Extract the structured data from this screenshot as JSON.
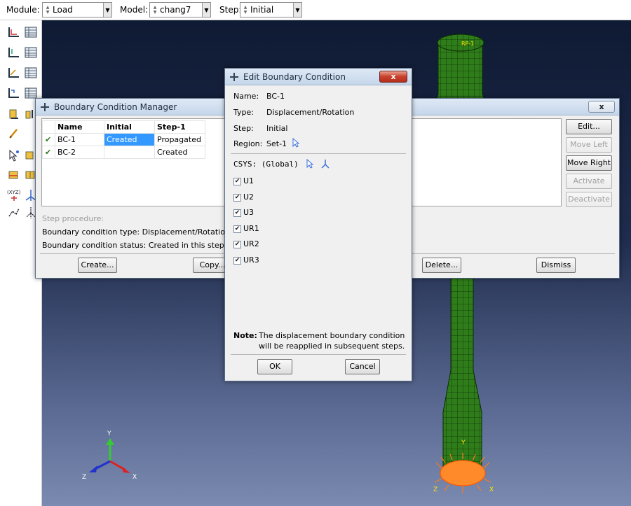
{
  "context": {
    "module_label": "Module:",
    "module_value": "Load",
    "model_label": "Model:",
    "model_value": "chang7",
    "step_label": "Step:",
    "step_value": "Initial"
  },
  "toolbox": {
    "tools": [
      "bc-manager-icon",
      "bc-create-icon",
      "load-create-icon",
      "load-manager-icon",
      "predefined-field-icon",
      "predefined-field-manager-icon",
      "interaction-icon",
      "interaction-manager-icon",
      "amplitude-icon",
      "edit-feature-icon",
      "query-icon",
      "csys-icon",
      "datum-icon",
      "partition-icon",
      "mesh-icon",
      "section-icon"
    ]
  },
  "manager": {
    "title": "Boundary Condition Manager",
    "close_label": "x",
    "columns": [
      "Name",
      "Initial",
      "Step-1"
    ],
    "rows": [
      {
        "check": "✔",
        "name": "BC-1",
        "initial": "Created",
        "step1": "Propagated"
      },
      {
        "check": "✔",
        "name": "BC-2",
        "initial": "",
        "step1": "Created"
      }
    ],
    "step_procedure": "Step procedure:",
    "bc_type": "Boundary condition type:  Displacement/Rotation",
    "bc_status": "Boundary condition status: Created in this step",
    "side_buttons": {
      "edit": "Edit...",
      "move_left": "Move Left",
      "move_right": "Move Right",
      "activate": "Activate",
      "deactivate": "Deactivate"
    },
    "bottom_buttons": {
      "create": "Create...",
      "copy": "Copy...",
      "delete": "Delete...",
      "dismiss": "Dismiss"
    }
  },
  "editor": {
    "title": "Edit Boundary Condition",
    "name_label": "Name:",
    "name_value": "BC-1",
    "type_label": "Type:",
    "type_value": "Displacement/Rotation",
    "step_label": "Step:",
    "step_value": "Initial",
    "region_label": "Region:",
    "region_value": "Set-1",
    "csys_label": "CSYS: (Global)",
    "dofs": [
      {
        "label": "U1",
        "checked": true
      },
      {
        "label": "U2",
        "checked": true
      },
      {
        "label": "U3",
        "checked": true
      },
      {
        "label": "UR1",
        "checked": true
      },
      {
        "label": "UR2",
        "checked": true
      },
      {
        "label": "UR3",
        "checked": true
      }
    ],
    "note_label": "Note:",
    "note_text_1": "The displacement boundary condition",
    "note_text_2": "will be reapplied in subsequent steps.",
    "ok_label": "OK",
    "cancel_label": "Cancel",
    "close_label": "x"
  },
  "viewport": {
    "rp_label": "RP-1",
    "triad": {
      "x": "X",
      "y": "Y",
      "z": "Z"
    },
    "model_axes": {
      "x": "X",
      "y": "Y",
      "z": "Z"
    }
  },
  "colors": {
    "mesh_green": "#2f7d1a",
    "bc_orange": "#ff7a1a",
    "selection_blue": "#3399ff"
  }
}
